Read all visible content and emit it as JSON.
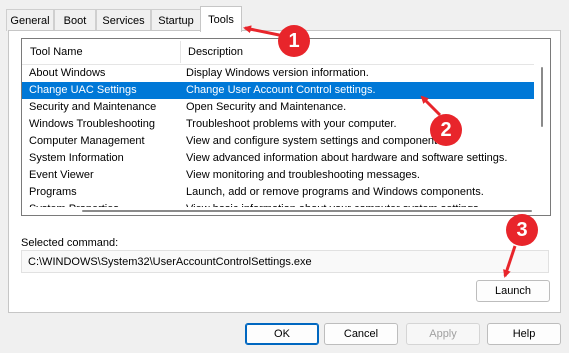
{
  "tabs": [
    {
      "label": "General"
    },
    {
      "label": "Boot"
    },
    {
      "label": "Services"
    },
    {
      "label": "Startup"
    },
    {
      "label": "Tools",
      "active": true
    }
  ],
  "list": {
    "headers": {
      "tool_name": "Tool Name",
      "description": "Description"
    },
    "rows": [
      {
        "name": "About Windows",
        "description": "Display Windows version information."
      },
      {
        "name": "Change UAC Settings",
        "description": "Change User Account Control settings.",
        "selected": true
      },
      {
        "name": "Security and Maintenance",
        "description": "Open Security and Maintenance."
      },
      {
        "name": "Windows Troubleshooting",
        "description": "Troubleshoot problems with your computer."
      },
      {
        "name": "Computer Management",
        "description": "View and configure system settings and components."
      },
      {
        "name": "System Information",
        "description": "View advanced information about hardware and software settings."
      },
      {
        "name": "Event Viewer",
        "description": "View monitoring and troubleshooting messages."
      },
      {
        "name": "Programs",
        "description": "Launch, add or remove programs and Windows components."
      },
      {
        "name": "System Properties",
        "description": "View basic information about your computer system settings."
      }
    ]
  },
  "selected_command": {
    "label": "Selected command:",
    "value": "C:\\WINDOWS\\System32\\UserAccountControlSettings.exe"
  },
  "buttons": {
    "launch": "Launch",
    "ok": "OK",
    "cancel": "Cancel",
    "apply": "Apply",
    "help": "Help"
  },
  "annotations": [
    {
      "number": "1"
    },
    {
      "number": "2"
    },
    {
      "number": "3"
    }
  ],
  "colors": {
    "selection": "#0078d7",
    "callout": "#e8252b",
    "default_button_border": "#0067c0"
  }
}
